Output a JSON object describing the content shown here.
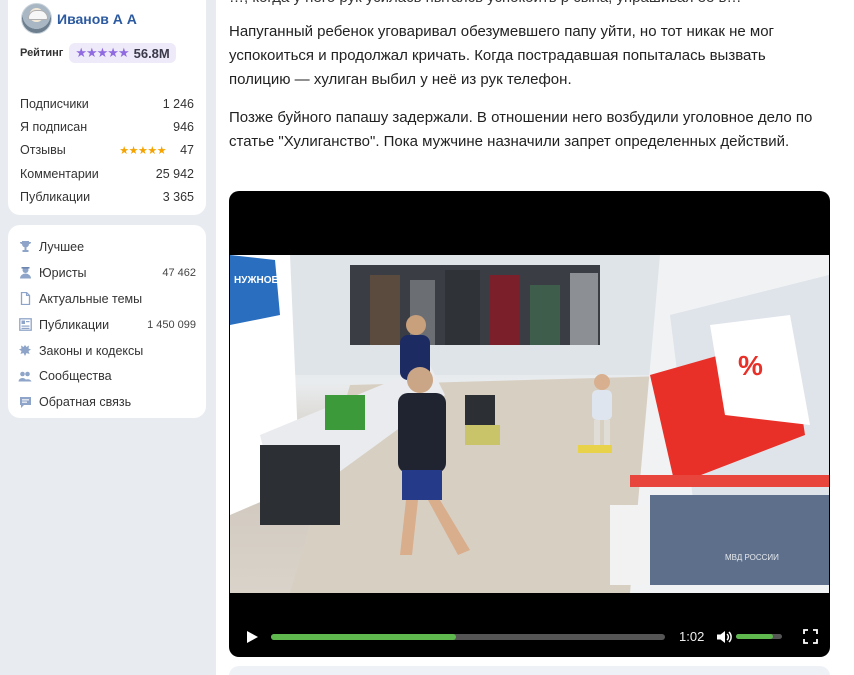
{
  "profile": {
    "username": "Иванов А А",
    "rating_label": "Рейтинг",
    "rating_stars": "★★★★★",
    "rating_value": "56.8M",
    "stats": [
      {
        "label": "Подписчики",
        "value": "1 246"
      },
      {
        "label": "Я подписан",
        "value": "946"
      },
      {
        "label": "Отзывы",
        "value": "47",
        "stars": "★★★★★"
      },
      {
        "label": "Комментарии",
        "value": "25 942"
      },
      {
        "label": "Публикации",
        "value": "3 365"
      }
    ]
  },
  "nav": {
    "items": [
      {
        "label": "Лучшее",
        "icon": "trophy-icon",
        "count": ""
      },
      {
        "label": "Юристы",
        "icon": "lawyer-icon",
        "count": "47 462"
      },
      {
        "label": "Актуальные темы",
        "icon": "document-icon",
        "count": ""
      },
      {
        "label": "Публикации",
        "icon": "publications-icon",
        "count": "1 450 099"
      },
      {
        "label": "Законы и кодексы",
        "icon": "emblem-icon",
        "count": ""
      },
      {
        "label": "Сообщества",
        "icon": "community-icon",
        "count": ""
      },
      {
        "label": "Обратная связь",
        "icon": "feedback-icon",
        "count": ""
      }
    ]
  },
  "article": {
    "partial_top": "…, когда у него рук усилась пытаясь успокоить р сына, упрашивая ее в…",
    "paragraph1": "Напуганный ребенок уговаривал обезумевшего папу уйти, но тот никак не мог успокоиться и продолжал кричать. Когда пострадавшая попыталась вызвать полицию — хулиган выбил у неё из рук телефон.",
    "paragraph2": "Позже буйного папашу задержали. В отношении него возбудили уголовное дело по статье \"Хулиганство\". Пока мужчине назначили запрет определенных действий."
  },
  "video": {
    "time": "1:02",
    "progress": 0.47,
    "volume": 0.8,
    "store_sign": "НУЖНОЕ",
    "sale_sign": "%",
    "watermark": "МВД РОССИИ"
  },
  "colors": {
    "accent_green": "#5eb84e",
    "link_blue": "#2c5aa0",
    "rating_purple": "#8f6ae0",
    "star_gold": "#f5a300"
  }
}
